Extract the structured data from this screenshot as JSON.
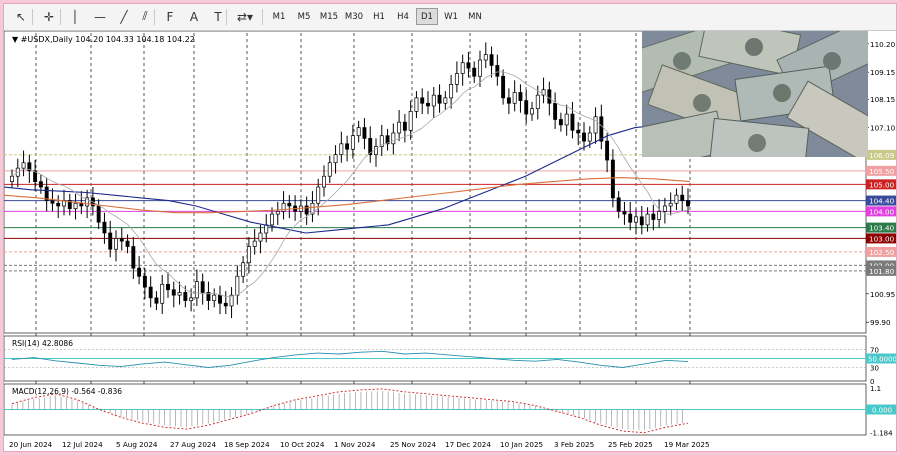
{
  "toolbar": {
    "tools": [
      {
        "name": "cursor-icon",
        "glyph": "↖"
      },
      {
        "name": "crosshair-icon",
        "glyph": "✛"
      },
      {
        "name": "vertical-line-icon",
        "glyph": "│"
      },
      {
        "name": "horizontal-line-icon",
        "glyph": "—"
      },
      {
        "name": "trendline-icon",
        "glyph": "╱"
      },
      {
        "name": "channel-icon",
        "glyph": "⫽"
      },
      {
        "name": "fibonacci-icon",
        "glyph": "F"
      },
      {
        "name": "text-icon",
        "glyph": "A"
      },
      {
        "name": "label-icon",
        "glyph": "T"
      },
      {
        "name": "shapes-icon",
        "glyph": "⇄▾"
      }
    ],
    "timeframes": [
      "M1",
      "M5",
      "M15",
      "M30",
      "H1",
      "H4",
      "D1",
      "W1",
      "MN"
    ],
    "active_timeframe": "D1"
  },
  "chart_header": {
    "symbol_line": "#USDX,Daily  104.20 104.33 104.18 104.22"
  },
  "price_axis": {
    "ticks": [
      "110.20",
      "109.15",
      "108.15",
      "107.10",
      "106.05",
      "104.95",
      "104.00",
      "102.95",
      "101.90",
      "100.95",
      "99.90"
    ],
    "levels": [
      {
        "label": "106.09",
        "color": "#c8c889",
        "price": 106.09
      },
      {
        "label": "105.50",
        "color": "#f0a0a0",
        "price": 105.5
      },
      {
        "label": "105.00",
        "color": "#cc2222",
        "price": 105.0
      },
      {
        "label": "104.40",
        "color": "#3a4a9a",
        "price": 104.4
      },
      {
        "label": "104.00",
        "color": "#e040e0",
        "price": 104.0
      },
      {
        "label": "103.40",
        "color": "#2a7a4a",
        "price": 103.4
      },
      {
        "label": "103.00",
        "color": "#8b0000",
        "price": 103.0
      },
      {
        "label": "102.50",
        "color": "#f0a0a0",
        "price": 102.5
      },
      {
        "label": "102.00",
        "color": "#7a7a7a",
        "price": 102.0
      },
      {
        "label": "101.80",
        "color": "#7a7a7a",
        "price": 101.8
      }
    ]
  },
  "rsi": {
    "title": "RSI(14) 42.8086",
    "ticks": [
      "70",
      "50.0000",
      "30",
      "0"
    ],
    "highlight_color": "#48c8c8"
  },
  "macd": {
    "title": "MACD(12,26,9) -0.564 -0.836",
    "ticks": [
      "1.1",
      "0.000",
      "-1.184"
    ],
    "highlight_color": "#48c8c8"
  },
  "time_axis": [
    "20 Jun 2024",
    "12 Jul 2024",
    "5 Aug 2024",
    "27 Aug 2024",
    "18 Sep 2024",
    "10 Oct 2024",
    "1 Nov 2024",
    "25 Nov 2024",
    "17 Dec 2024",
    "10 Jan 2025",
    "3 Feb 2025",
    "25 Feb 2025",
    "19 Mar 2025"
  ],
  "chart_data": {
    "type": "candlestick",
    "symbol": "#USDX",
    "timeframe": "Daily",
    "ohlc_last": {
      "open": 104.2,
      "high": 104.33,
      "low": 104.18,
      "close": 104.22
    },
    "close_series": [
      105.3,
      105.6,
      105.8,
      105.5,
      105.1,
      104.9,
      104.4,
      104.3,
      104.2,
      104.4,
      104.1,
      104.3,
      104.2,
      104.5,
      104.2,
      103.6,
      103.2,
      102.6,
      103.0,
      102.9,
      102.7,
      101.9,
      101.6,
      101.2,
      100.8,
      100.6,
      101.3,
      101.1,
      100.9,
      101.0,
      100.7,
      100.8,
      101.4,
      101.0,
      100.7,
      100.9,
      100.6,
      100.5,
      100.9,
      101.6,
      102.1,
      102.7,
      102.9,
      103.2,
      103.5,
      103.9,
      104.0,
      104.3,
      104.2,
      104.0,
      104.2,
      103.9,
      104.3,
      104.9,
      105.3,
      105.8,
      106.1,
      106.5,
      106.3,
      106.8,
      107.1,
      106.7,
      106.1,
      106.4,
      106.8,
      106.5,
      106.9,
      107.3,
      107.0,
      107.7,
      108.2,
      108.0,
      107.9,
      108.3,
      108.0,
      108.2,
      108.7,
      109.1,
      109.5,
      109.3,
      109.0,
      109.6,
      109.8,
      109.4,
      109.0,
      108.2,
      108.0,
      108.4,
      108.1,
      107.6,
      107.8,
      108.3,
      108.5,
      108.0,
      107.4,
      107.2,
      107.6,
      107.0,
      106.9,
      106.6,
      106.9,
      107.5,
      106.6,
      105.9,
      104.5,
      104.0,
      103.9,
      103.6,
      103.8,
      103.5,
      103.9,
      103.7,
      104.0,
      104.2,
      104.3,
      104.6,
      104.4,
      104.2
    ],
    "ma_blue": [
      104.9,
      104.8,
      104.75,
      104.7,
      104.6,
      104.5,
      104.4,
      104.2,
      103.9,
      103.6,
      103.4,
      103.2,
      103.3,
      103.4,
      103.5,
      103.8,
      104.1,
      104.5,
      104.9,
      105.3,
      105.8,
      106.3,
      106.8,
      107.1,
      107.2,
      107.2
    ],
    "ma_orange": [
      104.6,
      104.5,
      104.35,
      104.2,
      104.05,
      103.95,
      103.95,
      104.0,
      104.05,
      104.15,
      104.25,
      104.4,
      104.55,
      104.7,
      104.85,
      105.0,
      105.1,
      105.2,
      105.25,
      105.2,
      105.1
    ],
    "rsi_values": [
      48,
      52,
      45,
      40,
      35,
      32,
      38,
      42,
      36,
      30,
      35,
      44,
      52,
      58,
      62,
      60,
      64,
      66,
      60,
      62,
      58,
      54,
      50,
      46,
      44,
      48,
      42,
      35,
      30,
      38,
      46,
      43
    ],
    "macd_values": [
      0.3,
      0.6,
      0.8,
      0.5,
      0.0,
      -0.4,
      -0.7,
      -0.9,
      -1.0,
      -0.8,
      -0.5,
      -0.2,
      0.2,
      0.5,
      0.7,
      0.9,
      1.0,
      1.05,
      0.9,
      0.8,
      0.7,
      0.6,
      0.5,
      0.4,
      0.2,
      -0.1,
      -0.4,
      -0.8,
      -1.1,
      -1.184,
      -0.9,
      -0.7
    ]
  }
}
